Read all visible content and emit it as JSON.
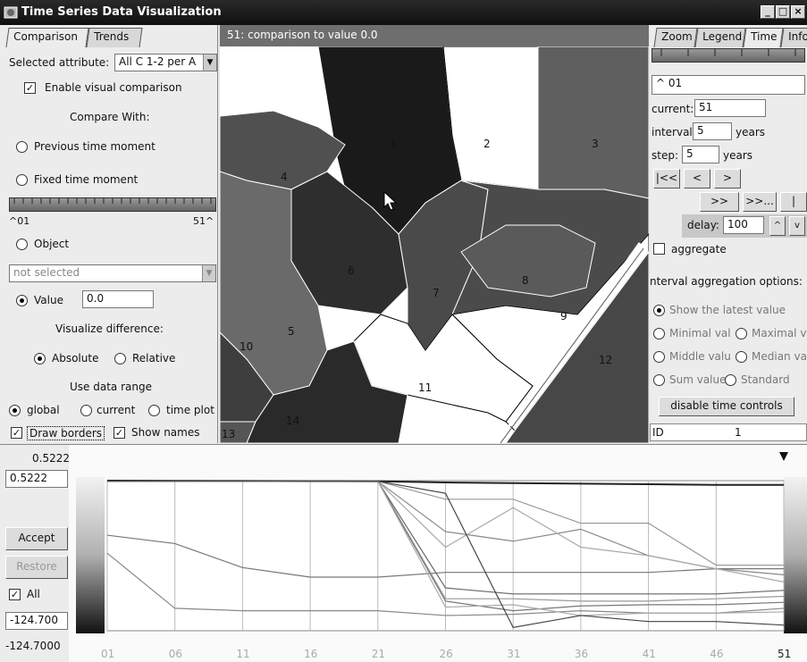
{
  "window": {
    "title": "Time Series Data Visualization"
  },
  "left": {
    "tabs": [
      "Comparison",
      "Trends"
    ],
    "selected_attribute_label": "Selected attribute:",
    "selected_attribute_value": "All C 1-2 per A",
    "enable_visual_comparison": "Enable visual comparison",
    "compare_with": "Compare With:",
    "previous_time_moment": "Previous time moment",
    "fixed_time_moment": "Fixed time moment",
    "slider_start": "^01",
    "slider_end": "51^",
    "object": "Object",
    "object_select": "not selected",
    "value_label": "Value",
    "value_input": "0.0",
    "visualize_difference": "Visualize difference:",
    "absolute": "Absolute",
    "relative": "Relative",
    "use_data_range": "Use data range",
    "global": "global",
    "current": "current",
    "time_plot": "time plot",
    "draw_borders": "Draw borders",
    "show_names": "Show names"
  },
  "map": {
    "header": "51: comparison to value 0.0",
    "region_labels": [
      "1",
      "2",
      "3",
      "4",
      "5",
      "6",
      "7",
      "8",
      "9",
      "10",
      "11",
      "12",
      "13",
      "14"
    ]
  },
  "right": {
    "tabs": [
      "Zoom",
      "Legend",
      "Time",
      "Info"
    ],
    "time_field": "01",
    "current_label": "current:",
    "current_value": "51",
    "interval_label": "interval:",
    "interval_value": "5",
    "years": "years",
    "step_label": "step:",
    "step_value": "5",
    "first_button": "|<<",
    "prev_button": "<",
    "next_button": ">",
    "fwd_button": ">>",
    "fwd_more_button": ">>...",
    "end_button": "|",
    "delay_label": "delay:",
    "delay_value": "100",
    "delay_up": "^",
    "delay_down": "v",
    "aggregate": "aggregate",
    "interval_aggregation_options": "nterval aggregation options:",
    "show_latest": "Show the latest value",
    "minimal": "Minimal val",
    "maximal": "Maximal v",
    "middle": "Middle valu",
    "median": "Median va",
    "sum": "Sum value",
    "standard": "Standard",
    "disable_time_controls": "disable time controls",
    "id_label": "ID",
    "id_value": "1"
  },
  "bottom": {
    "max_label": "0.5222",
    "max_input": "0.5222",
    "accept": "Accept",
    "restore": "Restore",
    "all": "All",
    "min_input": "-124.700",
    "min_label": "-124.7000"
  },
  "chart_data": {
    "type": "line",
    "x": [
      "01",
      "06",
      "11",
      "16",
      "21",
      "26",
      "31",
      "36",
      "41",
      "46",
      "51"
    ],
    "ylim": [
      -124.7,
      0.5222
    ],
    "series": [
      {
        "values": [
          0.5,
          0.3,
          0.2,
          0.1,
          0,
          -1,
          -1.5,
          -2,
          -2.5,
          -3,
          -3
        ]
      },
      {
        "values": [
          -45,
          -52,
          -72,
          -80,
          -80,
          -76,
          -76,
          -76,
          -76,
          -73,
          -73
        ]
      },
      {
        "values": [
          -60,
          -106,
          -108,
          -108,
          -108,
          -112,
          -111,
          -108,
          -110,
          -110,
          -106
        ]
      },
      {
        "values": [
          0,
          0,
          0,
          0,
          0,
          -15,
          -15,
          -35,
          -35,
          -70,
          -70
        ]
      },
      {
        "values": [
          0,
          0,
          0,
          0,
          0,
          -42,
          -50,
          -40,
          -62,
          -73,
          -78
        ]
      },
      {
        "values": [
          0,
          0,
          0,
          0,
          0,
          -55,
          -22,
          -55,
          -62,
          -73,
          -84
        ]
      },
      {
        "values": [
          0,
          0,
          0,
          0,
          0,
          -89,
          -94,
          -94,
          -94,
          -94,
          -91
        ]
      },
      {
        "values": [
          0,
          0,
          0,
          0,
          0,
          -98,
          -98,
          -100,
          -100,
          -98,
          -96
        ]
      },
      {
        "values": [
          0,
          0,
          0,
          0,
          0,
          -100,
          -108,
          -104,
          -103,
          -103,
          -101
        ]
      },
      {
        "values": [
          0,
          0,
          0,
          0,
          0,
          -105,
          -103,
          -112,
          -110,
          -110,
          -109
        ]
      },
      {
        "values": [
          0,
          0,
          0,
          0,
          0,
          -10,
          -122,
          -112,
          -117,
          -117,
          -120
        ]
      }
    ]
  }
}
